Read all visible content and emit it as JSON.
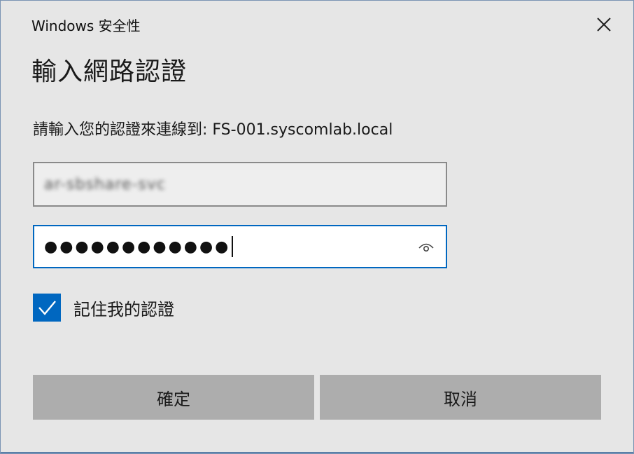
{
  "window": {
    "title": "Windows 安全性",
    "close_icon": "close-icon"
  },
  "dialog": {
    "heading": "輸入網路認證",
    "prompt": "請輸入您的認證來連線到: FS-001.syscomlab.local"
  },
  "username": {
    "value": "ar-sbshare-svc"
  },
  "password": {
    "masked_value": "●●●●●●●●●●●●",
    "reveal_icon": "eye-icon"
  },
  "remember": {
    "label": "記住我的認證",
    "checked": true
  },
  "buttons": {
    "ok_label": "確定",
    "cancel_label": "取消"
  },
  "colors": {
    "accent": "#0067c0",
    "button_bg": "#adadad",
    "dialog_bg": "#e6e6e6"
  }
}
